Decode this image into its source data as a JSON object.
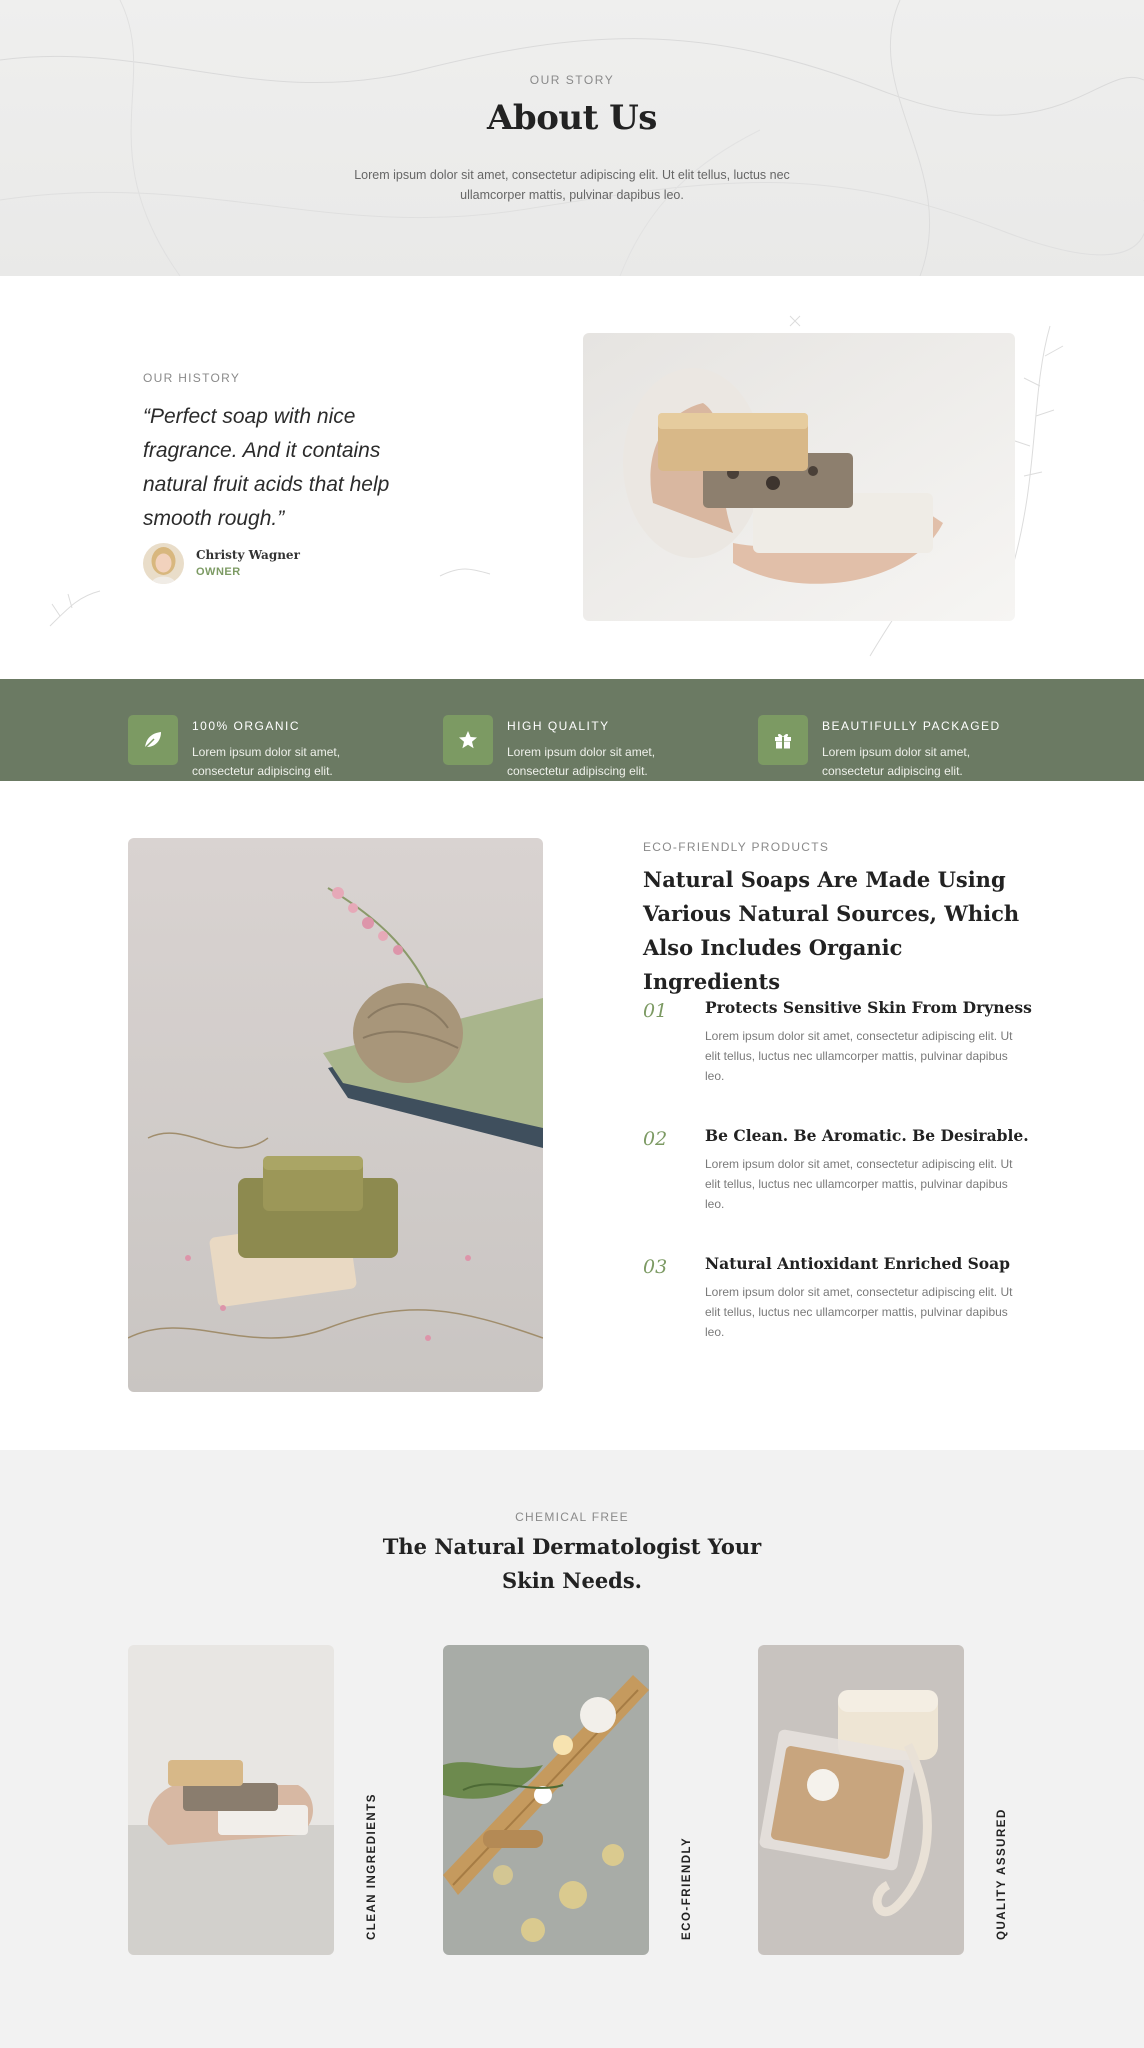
{
  "hero": {
    "eyebrow": "OUR STORY",
    "title": "About Us",
    "description": "Lorem ipsum dolor sit amet, consectetur adipiscing elit. Ut elit tellus, luctus nec ullamcorper mattis, pulvinar dapibus leo."
  },
  "history": {
    "eyebrow": "OUR HISTORY",
    "quote": "“Perfect soap with nice fragrance. And it contains natural fruit acids that help smooth rough.”",
    "author_name": "Christy Wagner",
    "author_role": "OWNER"
  },
  "features": [
    {
      "icon": "leaf-icon",
      "title": "100% ORGANIC",
      "text": "Lorem ipsum dolor sit amet, consectetur adipiscing elit."
    },
    {
      "icon": "star-icon",
      "title": "HIGH QUALITY",
      "text": "Lorem ipsum dolor sit amet, consectetur adipiscing elit."
    },
    {
      "icon": "gift-icon",
      "title": "BEAUTIFULLY PACKAGED",
      "text": "Lorem ipsum dolor sit amet, consectetur adipiscing elit."
    }
  ],
  "eco": {
    "eyebrow": "ECO-FRIENDLY PRODUCTS",
    "title": "Natural Soaps Are Made Using Various Natural Sources, Which Also Includes Organic Ingredients",
    "items": [
      {
        "num": "01",
        "title": "Protects Sensitive Skin From Dryness",
        "text": "Lorem ipsum dolor sit amet, consectetur adipiscing elit. Ut elit tellus, luctus nec ullamcorper mattis, pulvinar dapibus leo."
      },
      {
        "num": "02",
        "title": "Be Clean. Be Aromatic. Be Desirable.",
        "text": "Lorem ipsum dolor sit amet, consectetur adipiscing elit. Ut elit tellus, luctus nec ullamcorper mattis, pulvinar dapibus leo."
      },
      {
        "num": "03",
        "title": "Natural Antioxidant Enriched Soap",
        "text": "Lorem ipsum dolor sit amet, consectetur adipiscing elit. Ut elit tellus, luctus nec ullamcorper mattis, pulvinar dapibus leo."
      }
    ]
  },
  "chemical": {
    "eyebrow": "CHEMICAL FREE",
    "title": "The Natural Dermatologist Your Skin Needs.",
    "cards": [
      {
        "label": "CLEAN INGREDIENTS"
      },
      {
        "label": "ECO-FRIENDLY"
      },
      {
        "label": "QUALITY ASSURED"
      }
    ]
  },
  "colors": {
    "accent": "#7c9a63",
    "band": "#6b7a63",
    "heading": "#222222"
  }
}
